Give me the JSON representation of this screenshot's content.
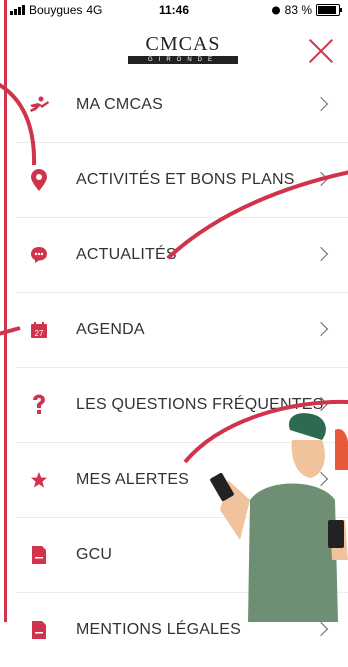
{
  "status_bar": {
    "carrier": "Bouygues",
    "network": "4G",
    "time": "11:46",
    "battery": "83 %"
  },
  "header": {
    "logo_text": "CMCAS",
    "logo_subtext": "GIRONDE"
  },
  "menu": {
    "items": [
      {
        "label": "MA CMCAS",
        "icon": "person-running-icon"
      },
      {
        "label": "ACTIVITÉS ET BONS PLANS",
        "icon": "map-pin-icon"
      },
      {
        "label": "ACTUALITÉS",
        "icon": "chat-bubble-icon"
      },
      {
        "label": "AGENDA",
        "icon": "calendar-icon",
        "icon_text": "27"
      },
      {
        "label": "LES QUESTIONS FRÉQUENTES",
        "icon": "question-mark-icon"
      },
      {
        "label": "MES ALERTES",
        "icon": "star-icon"
      },
      {
        "label": "GCU",
        "icon": "document-icon"
      },
      {
        "label": "MENTIONS LÉGALES",
        "icon": "document-icon"
      }
    ]
  },
  "colors": {
    "accent": "#d0334b",
    "text": "#333333",
    "separator": "#ececec"
  }
}
